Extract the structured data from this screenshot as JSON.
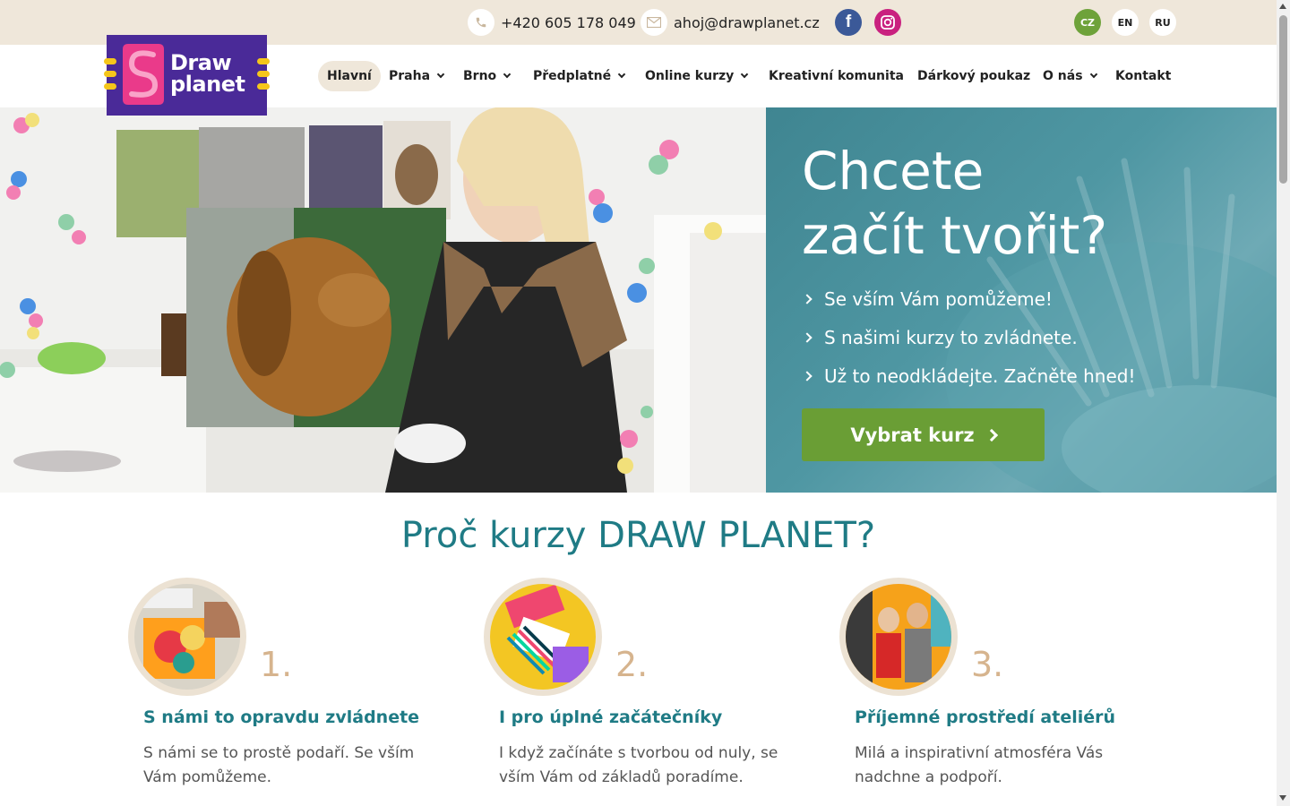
{
  "topbar": {
    "phone": "+420 605 178 049",
    "email": "ahoj@drawplanet.cz",
    "phone_icon": "phone-icon",
    "mail_icon": "mail-icon",
    "facebook_icon": "facebook-icon",
    "instagram_icon": "instagram-icon",
    "languages": [
      "CZ",
      "EN",
      "RU"
    ],
    "active_language": "CZ"
  },
  "logo": {
    "line1": "Draw",
    "line2": "planet"
  },
  "nav": {
    "items": [
      {
        "label": "Hlavní",
        "active": true,
        "dropdown": false
      },
      {
        "label": "Praha",
        "dropdown": true
      },
      {
        "label": "Brno",
        "dropdown": true
      },
      {
        "label": "Předplatné",
        "dropdown": true
      },
      {
        "label": "Online kurzy",
        "dropdown": true
      },
      {
        "label": "Kreativní komunita",
        "dropdown": false
      },
      {
        "label": "Dárkový poukaz",
        "dropdown": false
      },
      {
        "label": "O nás",
        "dropdown": true
      },
      {
        "label": "Kontakt",
        "dropdown": false
      }
    ]
  },
  "hero": {
    "title_line1": "Chcete",
    "title_line2": "začít tvořit?",
    "bullets": [
      "Se vším Vám pomůžeme!",
      "S našimi kurzy to zvládnete.",
      "Už to neodkládejte. Začněte hned!"
    ],
    "cta_label": "Vybrat kurz"
  },
  "section": {
    "title": "Proč kurzy DRAW PLANET?",
    "features": [
      {
        "number": "1.",
        "heading": "S námi to opravdu zvládnete",
        "text": "S námi se to prostě podaří. Se vším Vám pomůžeme."
      },
      {
        "number": "2.",
        "heading": "I pro úplné začátečníky",
        "text": "I když začínáte s tvorbou od nuly, se vším Vám od základů poradíme."
      },
      {
        "number": "3.",
        "heading": "Příjemné prostředí ateliérů",
        "text": "Milá a inspirativní atmosféra Vás nadchne a podpoří."
      }
    ]
  },
  "colors": {
    "topbar_bg": "#efe7da",
    "logo_bg": "#4a2a98",
    "accent_teal": "#1f7b85",
    "cta_green": "#6a9e35",
    "number_tan": "#d6b48e"
  }
}
